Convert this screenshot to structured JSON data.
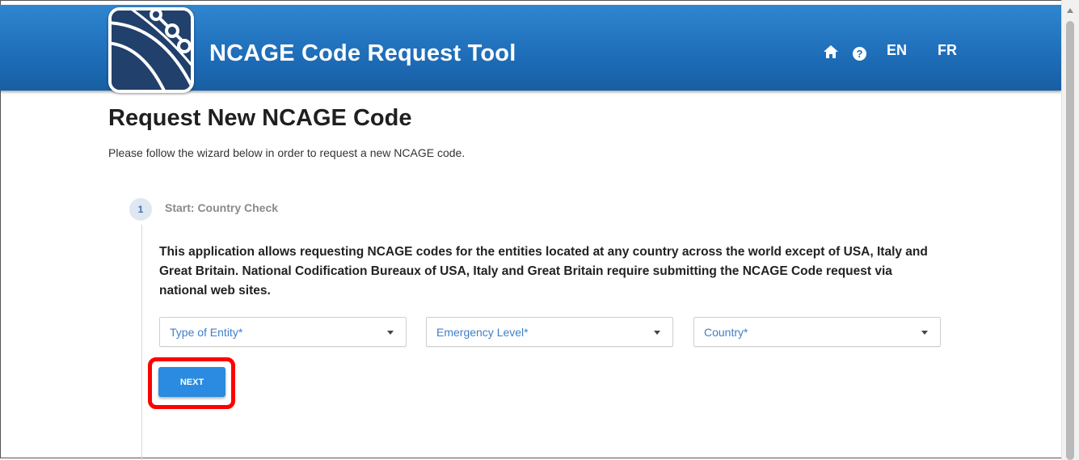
{
  "header": {
    "app_title": "NCAGE Code Request Tool",
    "nav": {
      "home_icon": "home-icon",
      "help_icon": "help-icon",
      "help_glyph": "?",
      "lang_en": "EN",
      "lang_fr": "FR"
    },
    "logo_icon": "satellite-globe-logo"
  },
  "page": {
    "title": "Request New NCAGE Code",
    "subtitle": "Please follow the wizard below in order to request a new NCAGE code."
  },
  "wizard": {
    "step": {
      "number": "1",
      "label": "Start: Country Check"
    },
    "info_text": "This application allows requesting NCAGE codes for the entities located at any country across the world except of USA, Italy and Great Britain. National Codification Bureaux of USA, Italy and Great Britain require submitting the NCAGE Code request via national web sites.",
    "selects": [
      {
        "placeholder": "Type of Entity*"
      },
      {
        "placeholder": "Emergency Level*"
      },
      {
        "placeholder": "Country*"
      }
    ],
    "next_label": "NEXT"
  },
  "colors": {
    "header_blue": "#1e6db8",
    "accent_blue": "#2a8be0",
    "highlight_red": "#ff0000"
  }
}
